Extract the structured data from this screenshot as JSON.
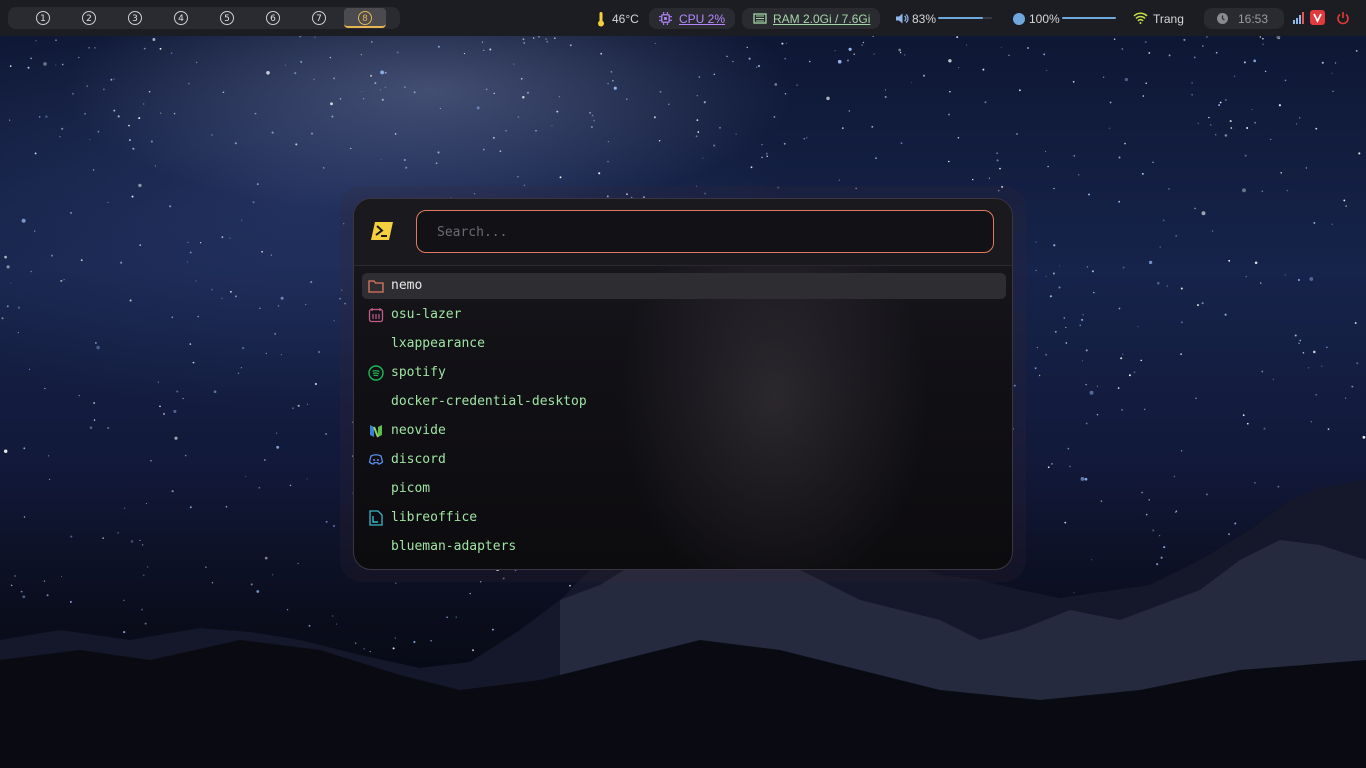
{
  "workspaces": {
    "items": [
      "1",
      "2",
      "3",
      "4",
      "5",
      "6",
      "7",
      "8"
    ],
    "active_index": 7
  },
  "status": {
    "temperature": "46°C",
    "cpu": "CPU 2%",
    "ram": "RAM 2.0Gi / 7.6Gi",
    "volume": "83%",
    "volume_level": 0.83,
    "brightness": "100%",
    "brightness_level": 1.0,
    "wifi": "Trang",
    "clock": "16:53"
  },
  "launcher": {
    "search_placeholder": "Search...",
    "items": [
      {
        "label": "nemo",
        "icon": "folder-icon",
        "selected": true
      },
      {
        "label": "osu-lazer",
        "icon": "osu-icon",
        "selected": false
      },
      {
        "label": "lxappearance",
        "icon": "",
        "selected": false
      },
      {
        "label": "spotify",
        "icon": "spotify-icon",
        "selected": false
      },
      {
        "label": "docker-credential-desktop",
        "icon": "",
        "selected": false
      },
      {
        "label": "neovide",
        "icon": "neovide-icon",
        "selected": false
      },
      {
        "label": "discord",
        "icon": "discord-icon",
        "selected": false
      },
      {
        "label": "picom",
        "icon": "",
        "selected": false
      },
      {
        "label": "libreoffice",
        "icon": "libreoffice-icon",
        "selected": false
      },
      {
        "label": "blueman-adapters",
        "icon": "",
        "selected": false
      }
    ]
  },
  "colors": {
    "accent": "#e07a5f",
    "item_text": "#9fe3a3",
    "active_workspace": "#e6b450",
    "cpu": "#b388ff",
    "ram": "#a5d6a7",
    "slider": "#6fa8dc",
    "power": "#e53935"
  }
}
